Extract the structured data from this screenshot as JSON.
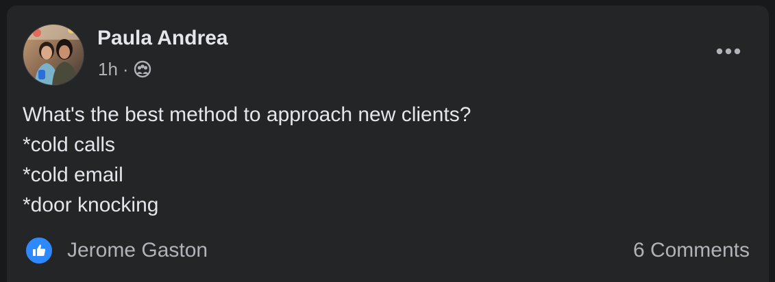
{
  "post": {
    "author": "Paula Andrea",
    "timestamp": "1h",
    "separator": "·",
    "audience_icon": "group-audience-icon",
    "more_icon": "more-options-icon",
    "body_lines": [
      "What's the best method to approach new clients?",
      "*cold calls",
      "*cold email",
      "*door knocking"
    ]
  },
  "reactions": {
    "icon": "like-icon",
    "reactor": "Jerome Gaston",
    "comments": "6 Comments"
  },
  "colors": {
    "page_background": "#18191a",
    "card_background": "#242526",
    "primary_text": "#e4e6eb",
    "secondary_text": "#b0b3b8",
    "like_blue": "#2e89ff"
  }
}
